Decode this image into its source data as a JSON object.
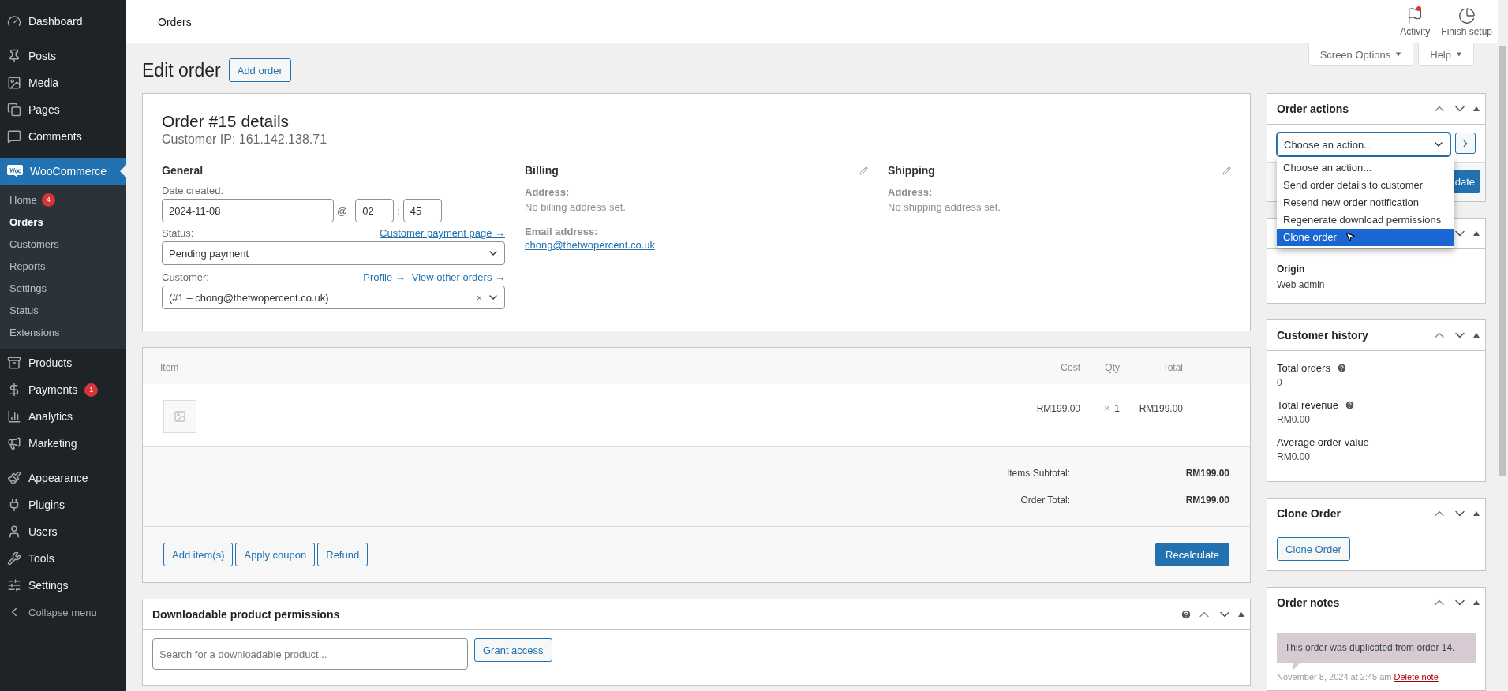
{
  "sidebar": {
    "items": [
      {
        "label": "Dashboard",
        "selected": false
      },
      {
        "label": "Posts",
        "selected": false
      },
      {
        "label": "Media",
        "selected": false
      },
      {
        "label": "Pages",
        "selected": false
      },
      {
        "label": "Comments",
        "selected": false
      },
      {
        "label": "WooCommerce",
        "selected": true,
        "children": [
          {
            "label": "Home",
            "badge": "4",
            "selected": false
          },
          {
            "label": "Orders",
            "selected": true
          },
          {
            "label": "Customers",
            "selected": false
          },
          {
            "label": "Reports",
            "selected": false
          },
          {
            "label": "Settings",
            "selected": false
          },
          {
            "label": "Status",
            "selected": false
          },
          {
            "label": "Extensions",
            "selected": false
          }
        ]
      },
      {
        "label": "Products",
        "selected": false
      },
      {
        "label": "Payments",
        "badge": "1",
        "selected": false
      },
      {
        "label": "Analytics",
        "selected": false
      },
      {
        "label": "Marketing",
        "selected": false
      },
      {
        "label": "Appearance",
        "selected": false
      },
      {
        "label": "Plugins",
        "selected": false
      },
      {
        "label": "Users",
        "selected": false
      },
      {
        "label": "Tools",
        "selected": false
      },
      {
        "label": "Settings",
        "selected": false
      },
      {
        "label": "Collapse menu",
        "selected": false
      }
    ]
  },
  "top_bar": {
    "title": "Orders",
    "actions": [
      {
        "label": "Activity",
        "notification": true
      },
      {
        "label": "Finish setup",
        "notification": false
      }
    ]
  },
  "screen_tabs": [
    "Screen Options",
    "Help"
  ],
  "page": {
    "title": "Edit order",
    "add_button": "Add order"
  },
  "order": {
    "heading": "Order #15 details",
    "customer_ip": "Customer IP: 161.142.138.71",
    "general": {
      "heading": "General",
      "date_label": "Date created:",
      "date": "2024-11-08",
      "at": "@",
      "hour": "02",
      "colon": ":",
      "minute": "45",
      "status_label": "Status:",
      "status_link": "Customer payment page →",
      "status": "Pending payment",
      "customer_label": "Customer:",
      "profile_link": "Profile →",
      "orders_link": "View other orders →",
      "customer": "(#1 – chong@thetwopercent.co.uk)",
      "clear": "×"
    },
    "billing": {
      "heading": "Billing",
      "address_label": "Address:",
      "address": "No billing address set.",
      "email_label": "Email address:",
      "email": "chong@thetwopercent.co.uk"
    },
    "shipping": {
      "heading": "Shipping",
      "address_label": "Address:",
      "address": "No shipping address set."
    }
  },
  "items": {
    "columns": [
      "Item",
      "Cost",
      "Qty",
      "Total"
    ],
    "rows": [
      {
        "cost": "RM199.00",
        "qty_sign": "×",
        "qty": "1",
        "total": "RM199.00"
      }
    ],
    "totals": [
      {
        "label": "Items Subtotal:",
        "value": "RM199.00"
      },
      {
        "label": "Order Total:",
        "value": "RM199.00"
      }
    ],
    "buttons": [
      "Add item(s)",
      "Apply coupon",
      "Refund"
    ],
    "recalculate": "Recalculate"
  },
  "downloads": {
    "title": "Downloadable product permissions",
    "placeholder": "Search for a downloadable product...",
    "button": "Grant access"
  },
  "order_actions": {
    "title": "Order actions",
    "select": "Choose an action...",
    "update_button": "date",
    "options": [
      {
        "label": "Choose an action...",
        "selected": false
      },
      {
        "label": "Send order details to customer",
        "selected": false
      },
      {
        "label": "Resend new order notification",
        "selected": false
      },
      {
        "label": "Regenerate download permissions",
        "selected": false
      },
      {
        "label": "Clone order",
        "selected": true
      }
    ]
  },
  "attribution": {
    "label": "Origin",
    "value": "Web admin"
  },
  "customer_history": {
    "title": "Customer history",
    "stats": [
      {
        "label": "Total orders",
        "value": "0",
        "help": true
      },
      {
        "label": "Total revenue",
        "value": "RM0.00",
        "help": true
      },
      {
        "label": "Average order value",
        "value": "RM0.00"
      }
    ]
  },
  "clone": {
    "title": "Clone Order",
    "button": "Clone Order"
  },
  "notes": {
    "title": "Order notes",
    "items": [
      {
        "text": "This order was duplicated from order 14.",
        "meta": "November 8, 2024 at 2:45 am",
        "delete": "Delete note"
      }
    ]
  }
}
